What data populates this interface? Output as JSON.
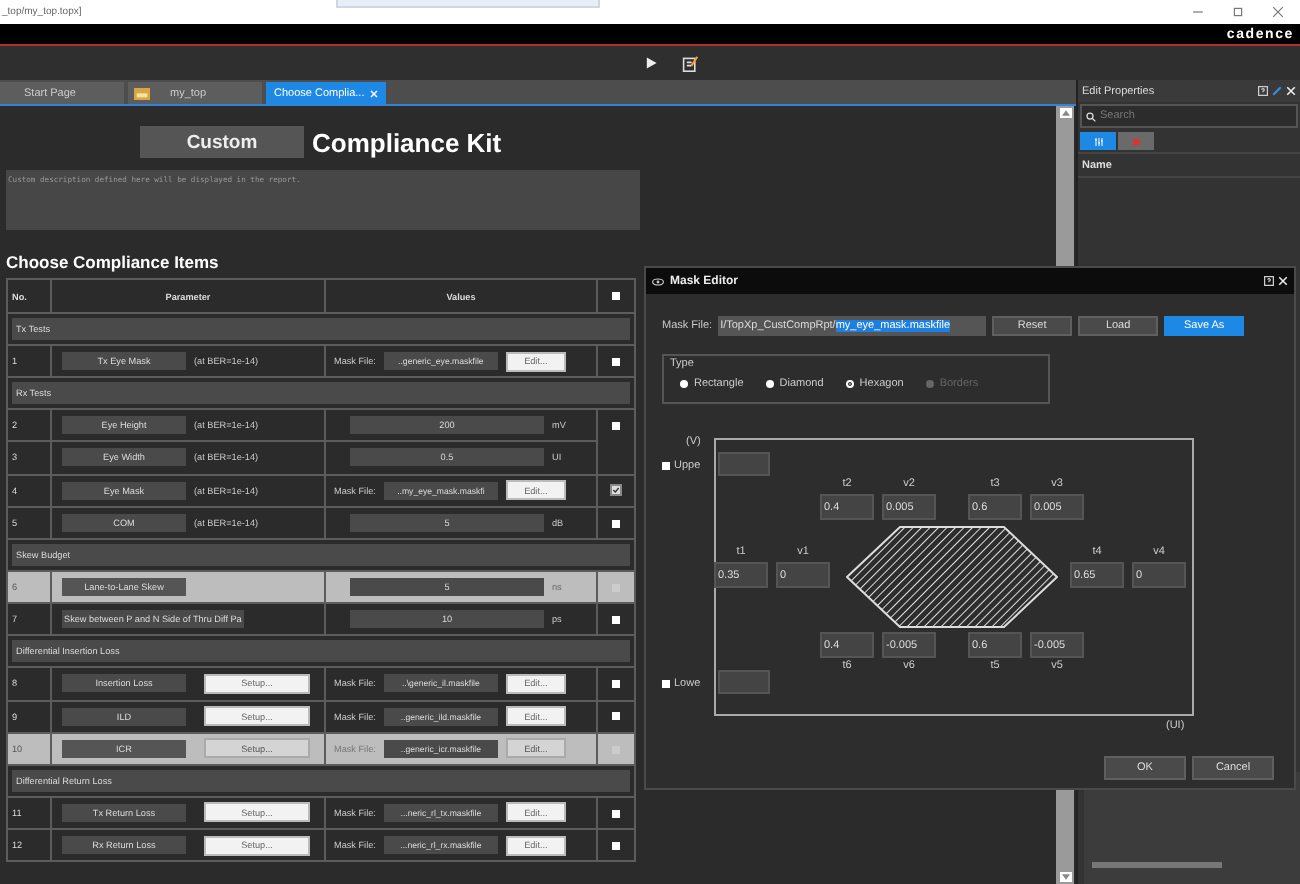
{
  "window": {
    "title": "_top/my_top.topx]",
    "brand": "cadence"
  },
  "tabs": [
    {
      "label": "Start Page",
      "kind": "page",
      "selected": false
    },
    {
      "label": "my_top",
      "kind": "design",
      "selected": false
    },
    {
      "label": "Choose Complia...",
      "kind": "page",
      "selected": true
    }
  ],
  "page": {
    "custom_label": "Custom",
    "heading": "Compliance Kit",
    "description": "Custom description defined here will be displayed in the report.",
    "section_title": "Choose Compliance Items"
  },
  "table": {
    "columns": [
      "No.",
      "Parameter",
      "Values"
    ],
    "all_checked": false,
    "rows": [
      {
        "kind": "section",
        "label": "Tx Tests"
      },
      {
        "kind": "row",
        "no": "1",
        "parameter": "Tx Eye Mask",
        "condition": "(at BER=1e-14)",
        "mask_label": "Mask File:",
        "mask_file": "..generic_eye.maskfile",
        "edit": "Edit...",
        "checked": false,
        "selected": false
      },
      {
        "kind": "section",
        "label": "Rx Tests"
      },
      {
        "kind": "row",
        "no": "2",
        "parameter": "Eye Height",
        "condition": "(at BER=1e-14)",
        "value": "200",
        "unit": "mV",
        "checked": false,
        "selected": false
      },
      {
        "kind": "row",
        "no": "3",
        "parameter": "Eye Width",
        "condition": "(at BER=1e-14)",
        "value": "0.5",
        "unit": "UI",
        "selected": false
      },
      {
        "kind": "row",
        "no": "4",
        "parameter": "Eye Mask",
        "condition": "(at BER=1e-14)",
        "mask_label": "Mask File:",
        "mask_file": "..my_eye_mask.maskfi",
        "edit": "Edit...",
        "checked": true,
        "selected": false
      },
      {
        "kind": "row",
        "no": "5",
        "parameter": "COM",
        "condition": "(at BER=1e-14)",
        "value": "5",
        "unit": "dB",
        "checked": false,
        "selected": false
      },
      {
        "kind": "section",
        "label": "Skew Budget"
      },
      {
        "kind": "row",
        "no": "6",
        "parameter": "Lane-to-Lane Skew",
        "value": "5",
        "unit": "ns",
        "checked": false,
        "selected": true
      },
      {
        "kind": "row",
        "no": "7",
        "parameter": "Skew between P and N Side of Thru Diff Pa",
        "value": "10",
        "unit": "ps",
        "checked": false,
        "selected": false
      },
      {
        "kind": "section",
        "label": "Differential Insertion Loss"
      },
      {
        "kind": "row",
        "no": "8",
        "parameter": "Insertion Loss",
        "setup": "Setup...",
        "mask_label": "Mask File:",
        "mask_file": "..\\generic_il.maskfile",
        "edit": "Edit...",
        "checked": false,
        "selected": false
      },
      {
        "kind": "row",
        "no": "9",
        "parameter": "ILD",
        "setup": "Setup...",
        "mask_label": "Mask File:",
        "mask_file": "..generic_ild.maskfile",
        "edit": "Edit...",
        "checked": false,
        "selected": false
      },
      {
        "kind": "row",
        "no": "10",
        "parameter": "ICR",
        "setup": "Setup...",
        "mask_label": "Mask File:",
        "mask_file": "..generic_icr.maskfile",
        "edit": "Edit...",
        "checked": false,
        "selected": true
      },
      {
        "kind": "section",
        "label": "Differential Return Loss"
      },
      {
        "kind": "row",
        "no": "11",
        "parameter": "Tx Return Loss",
        "setup": "Setup...",
        "mask_label": "Mask File:",
        "mask_file": "...neric_rl_tx.maskfile",
        "edit": "Edit...",
        "checked": false,
        "selected": false
      },
      {
        "kind": "row",
        "no": "12",
        "parameter": "Rx Return Loss",
        "setup": "Setup...",
        "mask_label": "Mask File:",
        "mask_file": "...neric_rl_rx.maskfile",
        "edit": "Edit...",
        "checked": false,
        "selected": false
      }
    ]
  },
  "properties_panel": {
    "title": "Edit Properties",
    "search": {
      "placeholder": "Search"
    },
    "views": [
      {
        "kind": "list",
        "selected": true
      },
      {
        "kind": "tag",
        "selected": false
      }
    ],
    "column": "Name"
  },
  "mask_editor": {
    "title": "Mask Editor",
    "file_label": "Mask File:",
    "file_path": "I/TopXp_CustCompRpt/",
    "file_name": "my_eye_mask.maskfile",
    "buttons": [
      {
        "label": "Reset",
        "primary": false
      },
      {
        "label": "Load",
        "primary": false
      },
      {
        "label": "Save As",
        "primary": true
      }
    ],
    "type_label": "Type",
    "types": [
      {
        "label": "Rectangle",
        "selected": false,
        "disabled": false
      },
      {
        "label": "Diamond",
        "selected": false,
        "disabled": false
      },
      {
        "label": "Hexagon",
        "selected": true,
        "disabled": false
      },
      {
        "label": "Borders",
        "selected": false,
        "disabled": true
      }
    ],
    "v_axis": "(V)",
    "t_axis": "(UI)",
    "upper": {
      "label": "Uppe",
      "checked": false
    },
    "lower": {
      "label": "Lowe",
      "checked": false
    },
    "points": [
      {
        "t_label": "t2",
        "t": "0.4",
        "v_label": "v2",
        "v": "0.005"
      },
      {
        "t_label": "t3",
        "t": "0.6",
        "v_label": "v3",
        "v": "0.005"
      },
      {
        "t_label": "t1",
        "t": "0.35",
        "v_label": "v1",
        "v": "0"
      },
      {
        "t_label": "t4",
        "t": "0.65",
        "v_label": "v4",
        "v": "0"
      },
      {
        "t_label": "t6",
        "t": "0.4",
        "v_label": "v6",
        "v": "-0.005"
      },
      {
        "t_label": "t5",
        "t": "0.6",
        "v_label": "v5",
        "v": "-0.005"
      }
    ],
    "actions": [
      "OK",
      "Cancel"
    ]
  }
}
